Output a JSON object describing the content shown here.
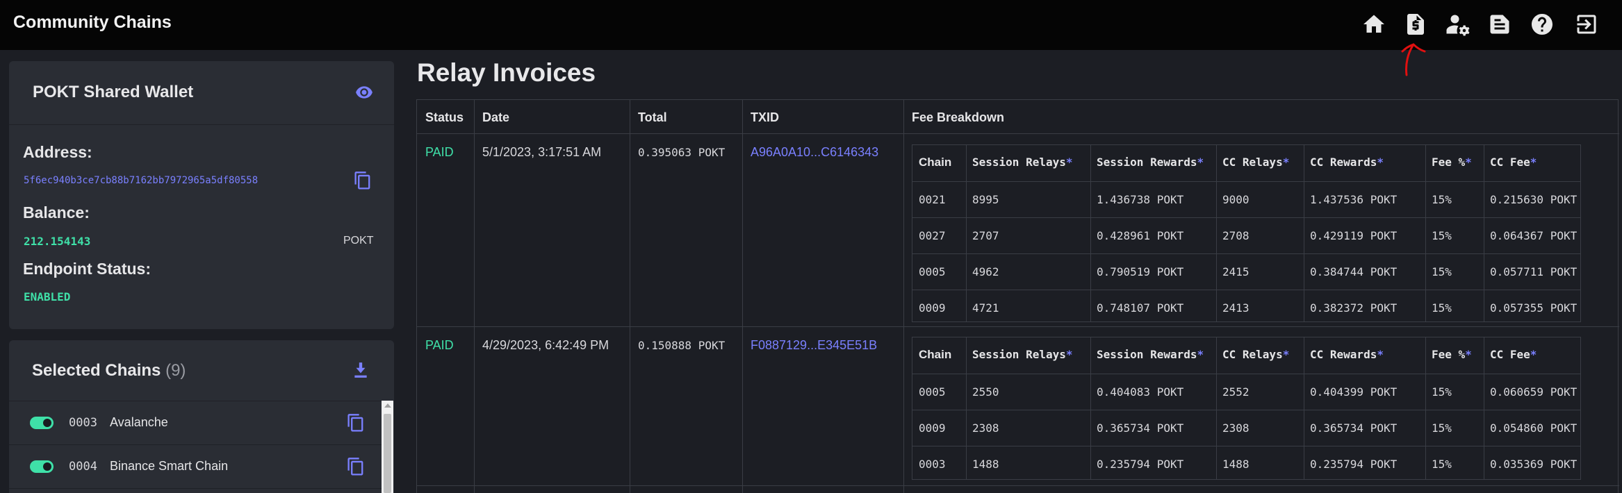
{
  "app": {
    "title": "Community Chains"
  },
  "nav": [
    {
      "name": "home-icon"
    },
    {
      "name": "invoice-icon"
    },
    {
      "name": "user-settings-icon"
    },
    {
      "name": "document-icon"
    },
    {
      "name": "help-icon"
    },
    {
      "name": "logout-icon"
    }
  ],
  "wallet": {
    "title": "POKT Shared Wallet",
    "address_label": "Address:",
    "address": "5f6ec940b3ce7cb88b7162bb7972965a5df80558",
    "balance_label": "Balance:",
    "balance": "212.154143",
    "balance_unit": "POKT",
    "status_label": "Endpoint Status:",
    "status": "ENABLED"
  },
  "chains": {
    "title": "Selected Chains",
    "count": "(9)",
    "items": [
      {
        "id": "0003",
        "name": "Avalanche"
      },
      {
        "id": "0004",
        "name": "Binance Smart Chain"
      }
    ]
  },
  "page": {
    "title": "Relay Invoices"
  },
  "table": {
    "headers": [
      "Status",
      "Date",
      "Total",
      "TXID",
      "Fee Breakdown"
    ],
    "fee_headers": [
      "Chain",
      "Session Relays",
      "Session Rewards",
      "CC Relays",
      "CC Rewards",
      "Fee %",
      "CC Fee"
    ],
    "fee_star": "*",
    "invoices": [
      {
        "status": "PAID",
        "date": "5/1/2023, 3:17:51 AM",
        "total": "0.395063 POKT",
        "txid": "A96A0A10...C6146343",
        "rows": [
          [
            "0021",
            "8995",
            "1.436738 POKT",
            "9000",
            "1.437536 POKT",
            "15%",
            "0.215630 POKT"
          ],
          [
            "0027",
            "2707",
            "0.428961 POKT",
            "2708",
            "0.429119 POKT",
            "15%",
            "0.064367 POKT"
          ],
          [
            "0005",
            "4962",
            "0.790519 POKT",
            "2415",
            "0.384744 POKT",
            "15%",
            "0.057711 POKT"
          ],
          [
            "0009",
            "4721",
            "0.748107 POKT",
            "2413",
            "0.382372 POKT",
            "15%",
            "0.057355 POKT"
          ]
        ]
      },
      {
        "status": "PAID",
        "date": "4/29/2023, 6:42:49 PM",
        "total": "0.150888 POKT",
        "txid": "F0887129...E345E51B",
        "rows": [
          [
            "0005",
            "2550",
            "0.404083 POKT",
            "2552",
            "0.404399 POKT",
            "15%",
            "0.060659 POKT"
          ],
          [
            "0009",
            "2308",
            "0.365734 POKT",
            "2308",
            "0.365734 POKT",
            "15%",
            "0.054860 POKT"
          ],
          [
            "0003",
            "1488",
            "0.235794 POKT",
            "1488",
            "0.235794 POKT",
            "15%",
            "0.035369 POKT"
          ]
        ]
      }
    ]
  },
  "colors": {
    "accent": "#7a80ff",
    "success": "#3fe0a8",
    "background": "#1c1e24",
    "panel": "#2a2d34"
  }
}
